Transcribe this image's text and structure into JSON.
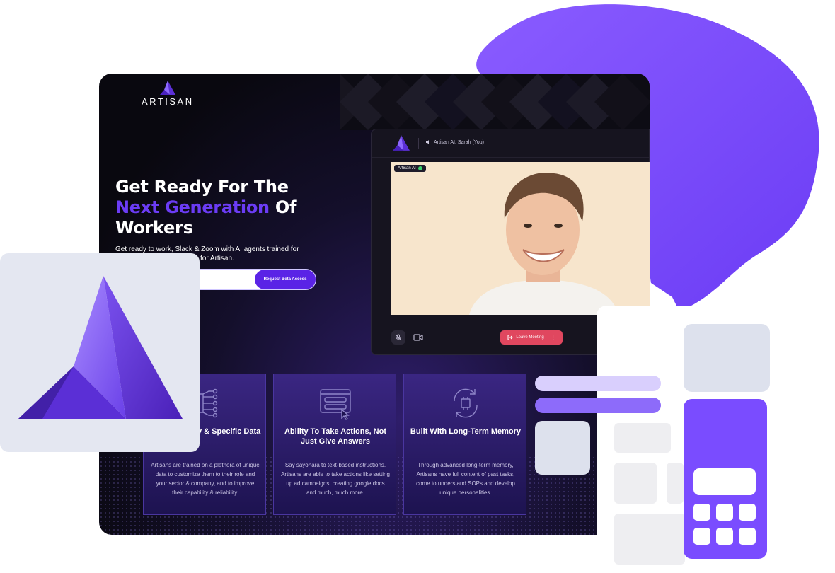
{
  "site": {
    "brand": "ARTISAN",
    "hero": {
      "title_line1": "Get Ready For The",
      "title_accent": "Next Generation",
      "title_mid": " Of",
      "title_line3": "Workers",
      "subtitle_a": "Get ready to work, Slack & Zoom with AI agents trained for",
      "subtitle_b": "for Artisan."
    },
    "cta": {
      "button_label": "Request Beta Access"
    }
  },
  "meeting": {
    "title": "Artisan AI, Sarah (You)",
    "tag": "Artisan AI",
    "leave_label": "Leave Meeting"
  },
  "cards": [
    {
      "title": "Role, Industry & Specific Data",
      "body": "Artisans are trained on a plethora of unique data to customize them to their role and your sector & company, and to improve their capability & reliability.",
      "icon": "circuit-brain-icon"
    },
    {
      "title": "Ability To Take Actions, Not Just Give Answers",
      "body": "Say sayonara to text-based instructions. Artisans are able to take actions like setting up ad campaigns, creating google docs and much, much more.",
      "icon": "browser-actions-icon"
    },
    {
      "title": "Built With Long-Term Memory",
      "body": "Through advanced long-term memory, Artisans have full content of past tasks, come to understand SOPs and develop unique personalities.",
      "icon": "chip-refresh-icon"
    }
  ],
  "colors": {
    "accent": "#6b3cf5",
    "button": "#5a23e6",
    "leave": "#e0475f",
    "blob": "#7a4cff"
  }
}
